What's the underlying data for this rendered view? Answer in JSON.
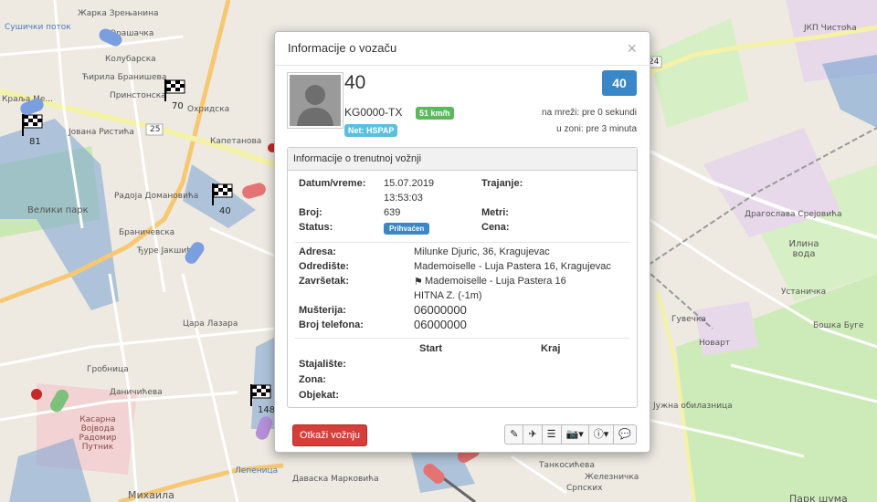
{
  "map": {
    "labels": [
      {
        "text": "Жарка Зрењанина"
      },
      {
        "text": "Орашачка"
      },
      {
        "text": "Сушички поток"
      },
      {
        "text": "Колубарска"
      },
      {
        "text": "Ћирила Бранишева"
      },
      {
        "text": "Принстонска"
      },
      {
        "text": "Краља Ме..."
      },
      {
        "text": "Јована Ристића"
      },
      {
        "text": "Охридска"
      },
      {
        "text": "Велики парк"
      },
      {
        "text": "Капетанова"
      },
      {
        "text": "Радоја Домановића"
      },
      {
        "text": "Браничевска"
      },
      {
        "text": "Ђуре Јакшића"
      },
      {
        "text": "Царa Лазара"
      },
      {
        "text": "Касарна Војвода Радомир Путник"
      },
      {
        "text": "Лепеница"
      },
      {
        "text": "Михаила"
      },
      {
        "text": "Даничићева"
      },
      {
        "text": "Гробница"
      },
      {
        "text": "Драгослава Срејовића"
      },
      {
        "text": "Илина вода"
      },
      {
        "text": "ЈКП Чистоћа"
      },
      {
        "text": "Новарт"
      },
      {
        "text": "Устаничка"
      },
      {
        "text": "Бошка Буге"
      },
      {
        "text": "Парк шума"
      },
      {
        "text": "Јужна обилазница"
      },
      {
        "text": "Гувечка"
      },
      {
        "text": "Железничка"
      },
      {
        "text": "Даваска Марковића"
      },
      {
        "text": "Танкосићева"
      },
      {
        "text": "Српских"
      }
    ],
    "markers": [
      {
        "num": "70"
      },
      {
        "num": "81"
      },
      {
        "num": "40"
      },
      {
        "num": "148"
      }
    ],
    "road_numbers": [
      "25",
      "24"
    ]
  },
  "modal": {
    "title": "Informacije o vozaču",
    "close": "×",
    "driver_number": "40",
    "plate": "KG0000-TX",
    "speed": "51 km/h",
    "network": "Net: HSPAP",
    "id_badge": "40",
    "online": "na mreži: pre 0 sekundi",
    "zone": "u zoni: pre 3 minuta",
    "panel_title": "Informacije o trenutnoj vožnji",
    "fields": {
      "datetime_label": "Datum/vreme:",
      "datetime_date": "15.07.2019",
      "datetime_time": "13:53:03",
      "duration_label": "Trajanje:",
      "number_label": "Broj:",
      "number_value": "639",
      "meters_label": "Metri:",
      "status_label": "Status:",
      "status_value": "Prihvaćen",
      "price_label": "Cena:",
      "address_label": "Adresa:",
      "address_value": "Milunke Djuric, 36, Kragujevac",
      "destination_label": "Odredište:",
      "destination_value": "Mademoiselle - Luja Pastera 16, Kragujevac",
      "end_label": "Završetak:",
      "end_value": "Mademoiselle - Luja Pastera 16",
      "end_note": "HITNA Z. (-1m)",
      "customer_label": "Mušterija:",
      "customer_value": "06000000",
      "phone_label": "Broj telefona:",
      "phone_value": "06000000",
      "start_col": "Start",
      "end_col": "Kraj",
      "stop_label": "Stajalište:",
      "zone_label": "Zona:",
      "object_label": "Objekat:"
    },
    "cancel_button": "Otkaži vožnju",
    "toolbar": {
      "edit": "✎",
      "plane": "✈",
      "list": "☰",
      "camera": "📷",
      "caret1": "▾",
      "info": "ⓘ",
      "caret2": "▾",
      "chat": "💬"
    }
  }
}
